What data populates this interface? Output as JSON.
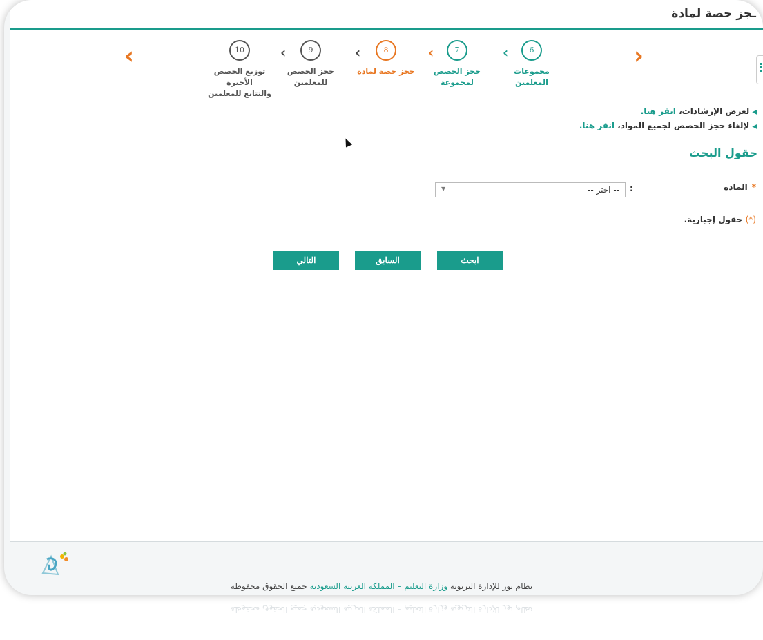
{
  "page_title": "ـجز حصة لمادة",
  "wizard": {
    "steps": [
      {
        "number": "6",
        "label_line1": "مجموعات المعلمين",
        "label_line2": "",
        "state": "done"
      },
      {
        "number": "7",
        "label_line1": "حجز الحصص",
        "label_line2": "لمجموعة",
        "state": "done"
      },
      {
        "number": "8",
        "label_line1": "حجز حصة لمادة",
        "label_line2": "",
        "state": "current"
      },
      {
        "number": "9",
        "label_line1": "حجز الحصص",
        "label_line2": "للمعلمين",
        "state": "pending"
      },
      {
        "number": "10",
        "label_line1": "توزيع الحصص الأخيرة",
        "label_line2": "والتتابع للمعلمين",
        "state": "pending"
      }
    ],
    "prev_arrow": "›",
    "next_arrow": "‹",
    "separator": "‹"
  },
  "links": {
    "instructions_text": "لعرض الإرشادات،",
    "instructions_link": "انقر هنا.",
    "cancel_text": "لإلغاء حجز الحصص لجميع المواد،",
    "cancel_link": "انقر هنا."
  },
  "search_section": {
    "title": "حقول البحث",
    "subject_label": "المادة",
    "required_marker": "*",
    "colon": ":",
    "subject_select_value": "-- اختر --",
    "mandatory_note": "حقول إجبارية.",
    "mandatory_star": "(*)"
  },
  "buttons": {
    "search": "ابحث",
    "previous": "السابق",
    "next": "التالي"
  },
  "footer": {
    "part1": "نظام نور للإدارة التربوية",
    "part2": "وزارة التعليم – المملكة العربية السعودية",
    "part3": "جميع الحقوق محفوظة"
  },
  "colors": {
    "accent": "#1a9c8c",
    "highlight": "#e87722"
  }
}
